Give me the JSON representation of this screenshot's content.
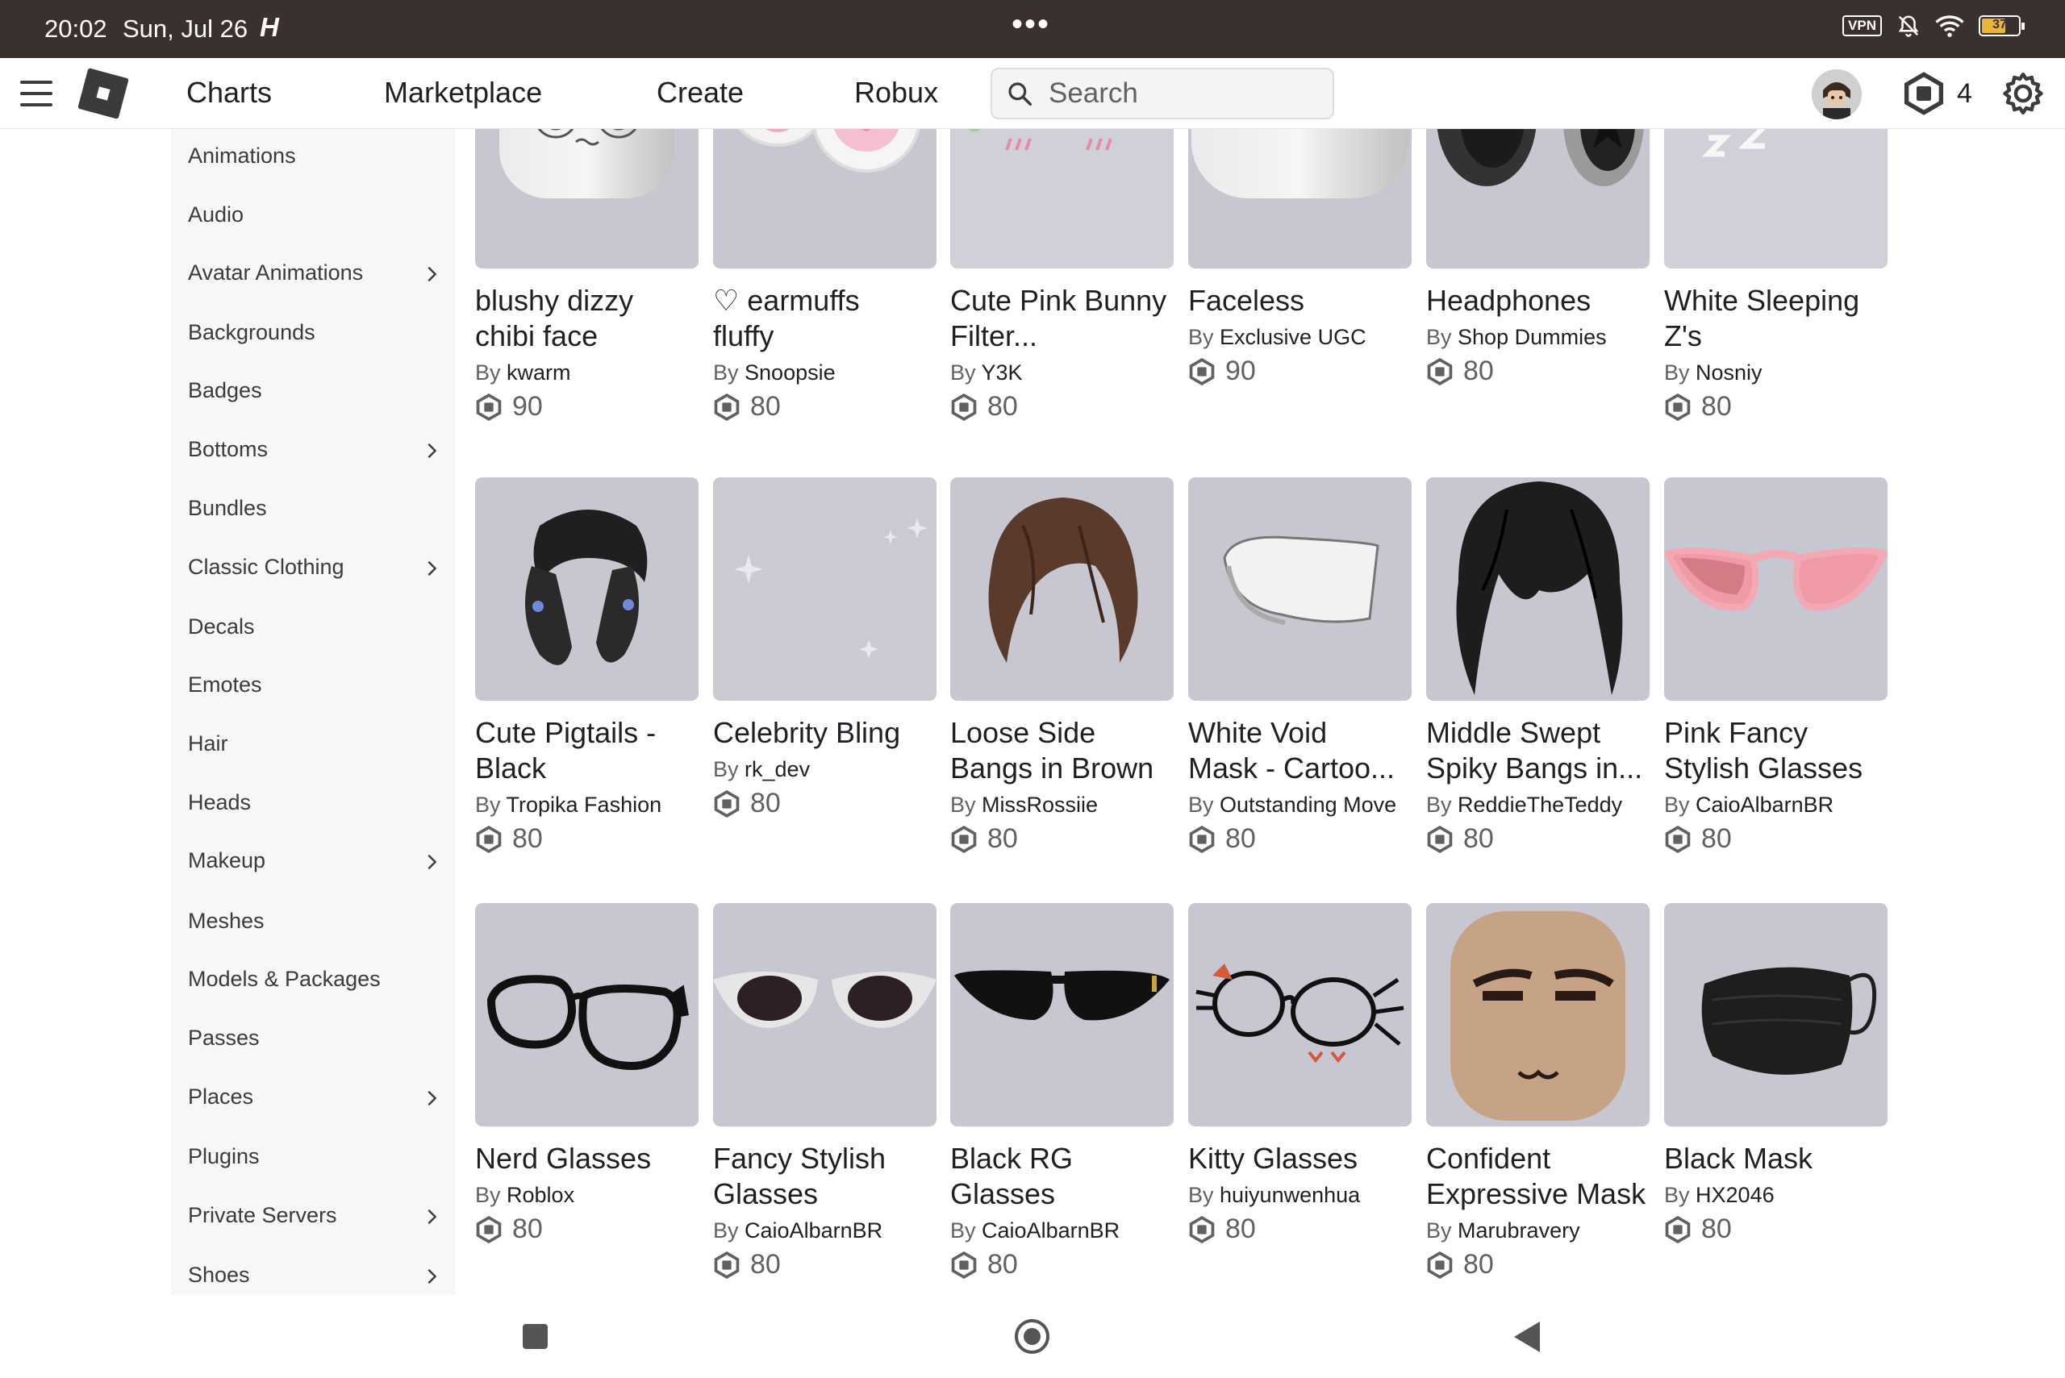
{
  "status_bar": {
    "time": "20:02",
    "date": "Sun, Jul 26",
    "app_glyph": "H",
    "dots": "•••",
    "vpn": "VPN",
    "battery": "37"
  },
  "nav": {
    "links": [
      "Charts",
      "Marketplace",
      "Create",
      "Robux"
    ],
    "search_placeholder": "Search",
    "robux_count": "4"
  },
  "sidebar": {
    "items": [
      {
        "label": "Animations",
        "has_submenu": false
      },
      {
        "label": "Audio",
        "has_submenu": false
      },
      {
        "label": "Avatar Animations",
        "has_submenu": true
      },
      {
        "label": "Backgrounds",
        "has_submenu": false
      },
      {
        "label": "Badges",
        "has_submenu": false
      },
      {
        "label": "Bottoms",
        "has_submenu": true
      },
      {
        "label": "Bundles",
        "has_submenu": false
      },
      {
        "label": "Classic Clothing",
        "has_submenu": true
      },
      {
        "label": "Decals",
        "has_submenu": false
      },
      {
        "label": "Emotes",
        "has_submenu": false
      },
      {
        "label": "Hair",
        "has_submenu": false
      },
      {
        "label": "Heads",
        "has_submenu": false
      },
      {
        "label": "Makeup",
        "has_submenu": true
      },
      {
        "label": "Meshes",
        "has_submenu": false
      },
      {
        "label": "Models & Packages",
        "has_submenu": false
      },
      {
        "label": "Passes",
        "has_submenu": false
      },
      {
        "label": "Places",
        "has_submenu": true
      },
      {
        "label": "Plugins",
        "has_submenu": false
      },
      {
        "label": "Private Servers",
        "has_submenu": true
      },
      {
        "label": "Shoes",
        "has_submenu": true
      }
    ]
  },
  "by_label": "By",
  "items": [
    {
      "name1": "blushy dizzy",
      "name2": "chibi face",
      "creator": "kwarm",
      "price": "90",
      "icon": "dizzy-face-icon"
    },
    {
      "name1": "♡ earmuffs",
      "name2": "fluffy",
      "creator": "Snoopsie",
      "price": "80",
      "icon": "earmuffs-icon"
    },
    {
      "name1": "Cute Pink Bunny",
      "name2": "Filter...",
      "creator": "Y3K",
      "price": "80",
      "icon": "bunny-filter-icon"
    },
    {
      "name1": "Faceless",
      "name2": "",
      "creator": "Exclusive UGC",
      "price": "90",
      "icon": "faceless-head-icon"
    },
    {
      "name1": "Headphones",
      "name2": "",
      "creator": "Shop Dummies",
      "price": "80",
      "icon": "headphones-icon"
    },
    {
      "name1": "White Sleeping",
      "name2": "Z's",
      "creator": "Nosniy",
      "price": "80",
      "icon": "sleeping-z-icon"
    },
    {
      "name1": "Cute Pigtails -",
      "name2": "Black",
      "creator": "Tropika Fashion",
      "price": "80",
      "icon": "pigtails-hair-icon"
    },
    {
      "name1": "Celebrity Bling",
      "name2": "",
      "creator": "rk_dev",
      "price": "80",
      "icon": "sparkles-icon"
    },
    {
      "name1": "Loose Side",
      "name2": "Bangs in Brown",
      "creator": "MissRossiie",
      "price": "80",
      "icon": "brown-bangs-icon"
    },
    {
      "name1": "White Void",
      "name2": "Mask - Cartoo...",
      "creator": "Outstanding Move",
      "price": "80",
      "icon": "void-mask-icon"
    },
    {
      "name1": "Middle Swept",
      "name2": "Spiky Bangs in...",
      "creator": "ReddieTheTeddy",
      "price": "80",
      "icon": "black-bangs-icon"
    },
    {
      "name1": "Pink Fancy",
      "name2": "Stylish Glasses",
      "creator": "CaioAlbarnBR",
      "price": "80",
      "icon": "pink-glasses-icon"
    },
    {
      "name1": "Nerd Glasses",
      "name2": "",
      "creator": "Roblox",
      "price": "80",
      "icon": "nerd-glasses-icon"
    },
    {
      "name1": "Fancy Stylish",
      "name2": "Glasses",
      "creator": "CaioAlbarnBR",
      "price": "80",
      "icon": "white-cat-eye-glasses-icon"
    },
    {
      "name1": "Black RG",
      "name2": "Glasses",
      "creator": "CaioAlbarnBR",
      "price": "80",
      "icon": "black-rg-glasses-icon"
    },
    {
      "name1": "Kitty Glasses",
      "name2": "",
      "creator": "huiyunwenhua",
      "price": "80",
      "icon": "kitty-glasses-icon"
    },
    {
      "name1": "Confident",
      "name2": "Expressive Mask",
      "creator": "Marubravery",
      "price": "80",
      "icon": "expressive-mask-icon"
    },
    {
      "name1": "Black Mask",
      "name2": "",
      "creator": "HX2046",
      "price": "80",
      "icon": "black-face-mask-icon"
    }
  ],
  "colors": {
    "status_bar_bg": "#3a302d",
    "thumb_bg": "#c6c7d0",
    "sidebar_bg": "#f7f7f8",
    "text": "#1f2023",
    "muted": "#606162"
  }
}
